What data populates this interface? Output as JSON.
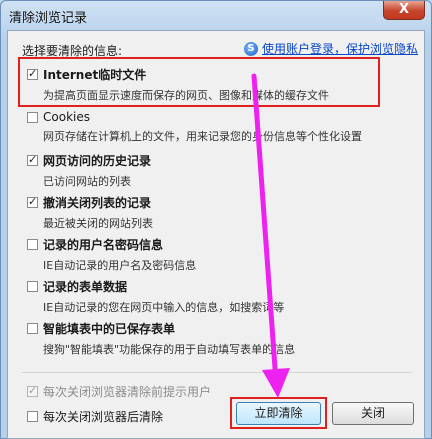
{
  "window": {
    "title": "清除浏览记录",
    "close_label": "X"
  },
  "header": {
    "section_label": "选择要清除的信息:",
    "account_link": "使用账户登录，保护浏览隐私",
    "account_icon": "S"
  },
  "items": [
    {
      "title": "Internet临时文件",
      "desc": "为提高页面显示速度而保存的网页、图像和媒体的缓存文件",
      "checked": true,
      "bold": true
    },
    {
      "title": "Cookies",
      "desc": "网页存储在计算机上的文件，用来记录您的身份信息等个性化设置",
      "checked": false,
      "bold": false
    },
    {
      "title": "网页访问的历史记录",
      "desc": "已访问网站的列表",
      "checked": true,
      "bold": true
    },
    {
      "title": "撤消关闭列表的记录",
      "desc": "最近被关闭的网站列表",
      "checked": true,
      "bold": true
    },
    {
      "title": "记录的用户名密码信息",
      "desc": "IE自动记录的用户名及密码信息",
      "checked": false,
      "bold": true
    },
    {
      "title": "记录的表单数据",
      "desc": "IE自动记录的您在网页中输入的信息，如搜索词等",
      "checked": false,
      "bold": true
    },
    {
      "title": "智能填表中的已保存表单",
      "desc": "搜狗\"智能填表\"功能保存的用于自动填写表单的信息",
      "checked": false,
      "bold": true
    }
  ],
  "footer": {
    "prompt_on_close": "每次关闭浏览器清除前提示用户",
    "clear_on_close": "每次关闭浏览器后清除",
    "clear_now_button": "立即清除",
    "close_button": "关闭"
  },
  "colors": {
    "highlight": "#e01f1f",
    "arrow": "#ee22ee",
    "link": "#0645c8"
  }
}
